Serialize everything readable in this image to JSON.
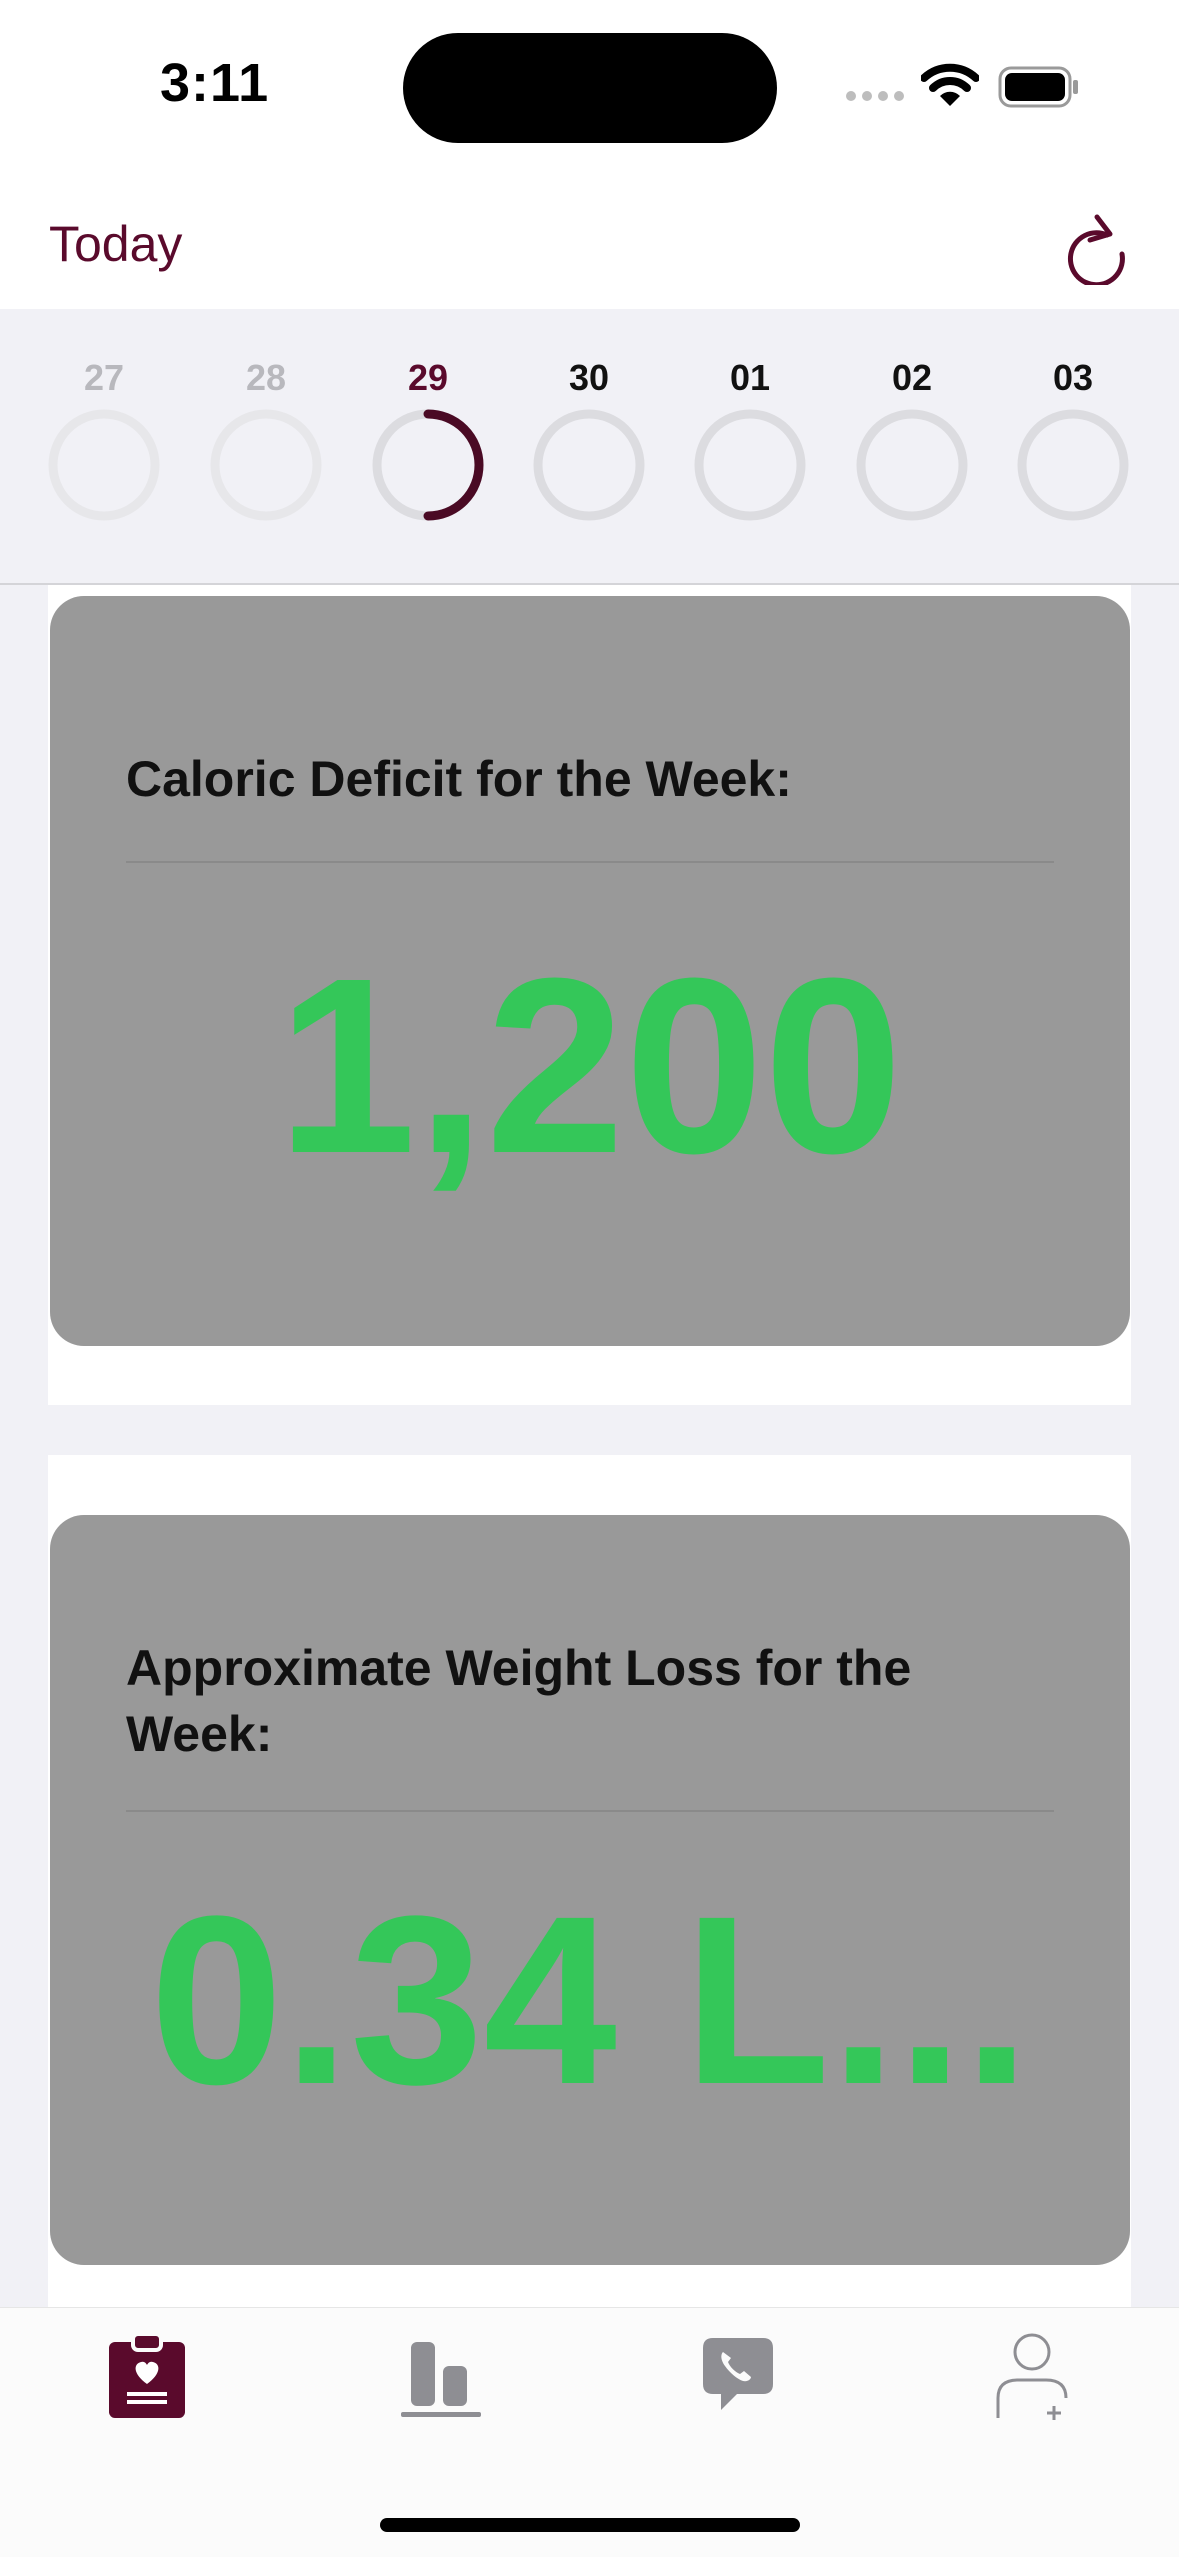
{
  "status_bar": {
    "time": "3:11"
  },
  "nav": {
    "title": "Today",
    "refresh_icon": "arrow-clockwise-icon",
    "accent": "#5a0a2c"
  },
  "week": {
    "days": [
      {
        "num": "27",
        "state": "past",
        "progress": 0
      },
      {
        "num": "28",
        "state": "past",
        "progress": 0
      },
      {
        "num": "29",
        "state": "current",
        "progress": 0.5
      },
      {
        "num": "30",
        "state": "future",
        "progress": 0
      },
      {
        "num": "01",
        "state": "future",
        "progress": 0
      },
      {
        "num": "02",
        "state": "future",
        "progress": 0
      },
      {
        "num": "03",
        "state": "future",
        "progress": 0
      }
    ]
  },
  "cards": {
    "deficit": {
      "title": "Caloric Deficit for the Week:",
      "value": "1,200"
    },
    "weight": {
      "title": "Approximate Weight Loss for the Week:",
      "value": "0.34 L..."
    }
  },
  "colors": {
    "value_green": "#34c759",
    "card_bg": "#999999"
  },
  "tabbar": {
    "tabs": [
      {
        "icon": "clipboard-heart-icon",
        "selected": true
      },
      {
        "icon": "bar-chart-icon",
        "selected": false
      },
      {
        "icon": "phone-bubble-icon",
        "selected": false
      },
      {
        "icon": "person-add-icon",
        "selected": false
      }
    ]
  }
}
